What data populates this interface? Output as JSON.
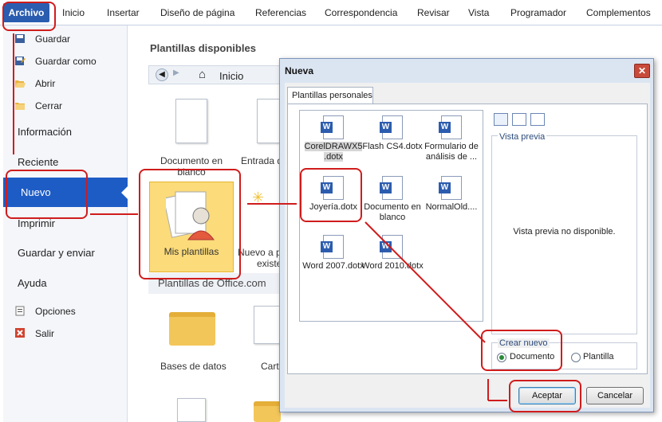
{
  "ribbon": {
    "file_tab": "Archivo",
    "tabs": [
      "Inicio",
      "Insertar",
      "Diseño de página",
      "Referencias",
      "Correspondencia",
      "Revisar",
      "Vista",
      "Programador",
      "Complementos"
    ]
  },
  "backstage_nav": {
    "save": "Guardar",
    "save_as": "Guardar como",
    "open": "Abrir",
    "close": "Cerrar",
    "info": "Información",
    "recent": "Reciente",
    "new": "Nuevo",
    "print": "Imprimir",
    "share": "Guardar y enviar",
    "help": "Ayuda",
    "options": "Opciones",
    "exit": "Salir"
  },
  "templates": {
    "heading": "Plantillas disponibles",
    "breadcrumb": "Inicio",
    "blank_doc": "Documento en blanco",
    "blog_post": "Entrada d",
    "my_templates": "Mis plantillas",
    "new_from_existing_1": "Nuevo a p",
    "new_from_existing_2": "existe",
    "office_heading": "Plantillas de Office.com",
    "databases": "Bases de datos",
    "cards": "Cart"
  },
  "dialog": {
    "title": "Nueva",
    "close_glyph": "✕",
    "tab_personal": "Plantillas personales",
    "files": [
      {
        "name": "CorelDRAWX5 .dotx"
      },
      {
        "name": "Flash CS4.dotx"
      },
      {
        "name": "Formulario de análisis de ..."
      },
      {
        "name": "Joyería.dotx"
      },
      {
        "name": "Documento en blanco"
      },
      {
        "name": "NormalOld...."
      },
      {
        "name": "Word 2007.dotx"
      },
      {
        "name": "Word 2010.dotx"
      }
    ],
    "preview_label": "Vista previa",
    "preview_message": "Vista previa no disponible.",
    "create_new_label": "Crear nuevo",
    "radio_document": "Documento",
    "radio_template": "Plantilla",
    "accept": "Aceptar",
    "cancel": "Cancelar"
  },
  "colors": {
    "accent": "#1e5cc5",
    "file_tab": "#2a5db0",
    "annotation": "#d01c1c"
  }
}
